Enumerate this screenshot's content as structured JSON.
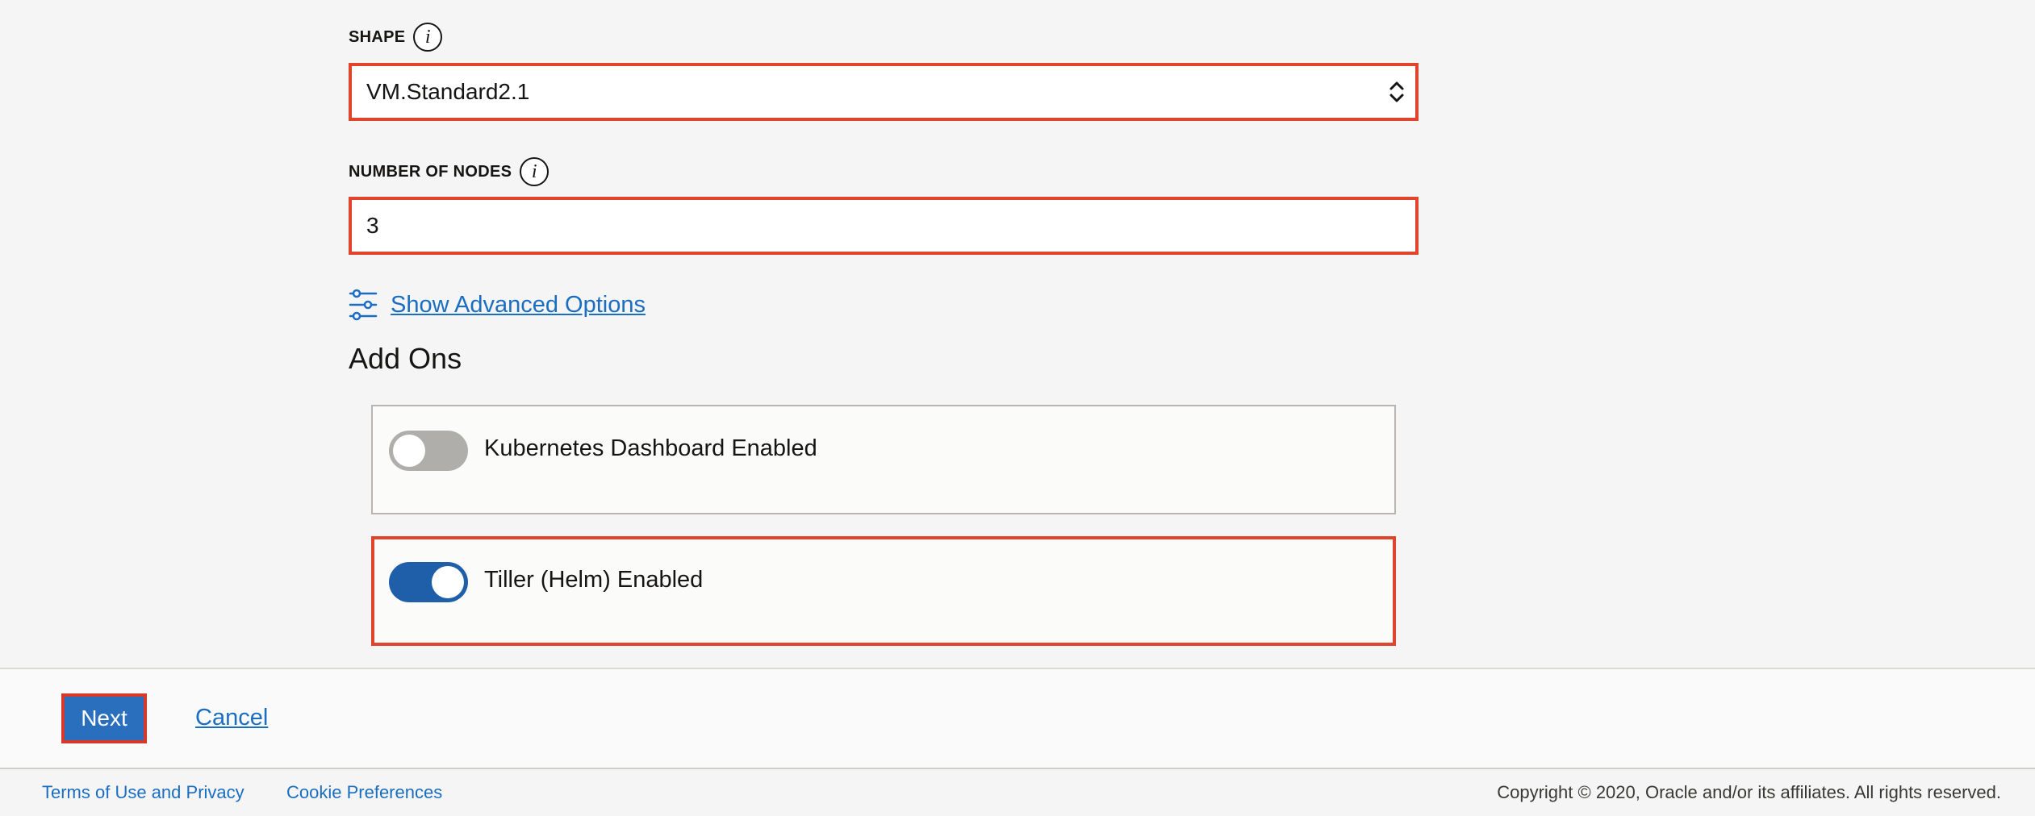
{
  "form": {
    "shape": {
      "label": "SHAPE",
      "info_icon": "info-icon",
      "value": "VM.Standard2.1"
    },
    "nodes": {
      "label": "NUMBER OF NODES",
      "info_icon": "info-icon",
      "value": "3"
    },
    "advanced": {
      "icon": "sliders-icon",
      "link_label": "Show Advanced Options"
    }
  },
  "addons": {
    "title": "Add Ons",
    "items": [
      {
        "label": "Kubernetes Dashboard Enabled",
        "enabled": false
      },
      {
        "label": "Tiller (Helm) Enabled",
        "enabled": true
      }
    ]
  },
  "actions": {
    "next_label": "Next",
    "cancel_label": "Cancel"
  },
  "footer": {
    "terms_label": "Terms of Use and Privacy",
    "cookie_label": "Cookie Preferences",
    "copyright": "Copyright © 2020, Oracle and/or its affiliates. All rights reserved."
  },
  "colors": {
    "highlight_border": "#e0452c",
    "link": "#1a6ec2",
    "primary_button": "#2a6fbe",
    "toggle_on": "#1f5ea8",
    "toggle_off": "#b0aeab"
  }
}
